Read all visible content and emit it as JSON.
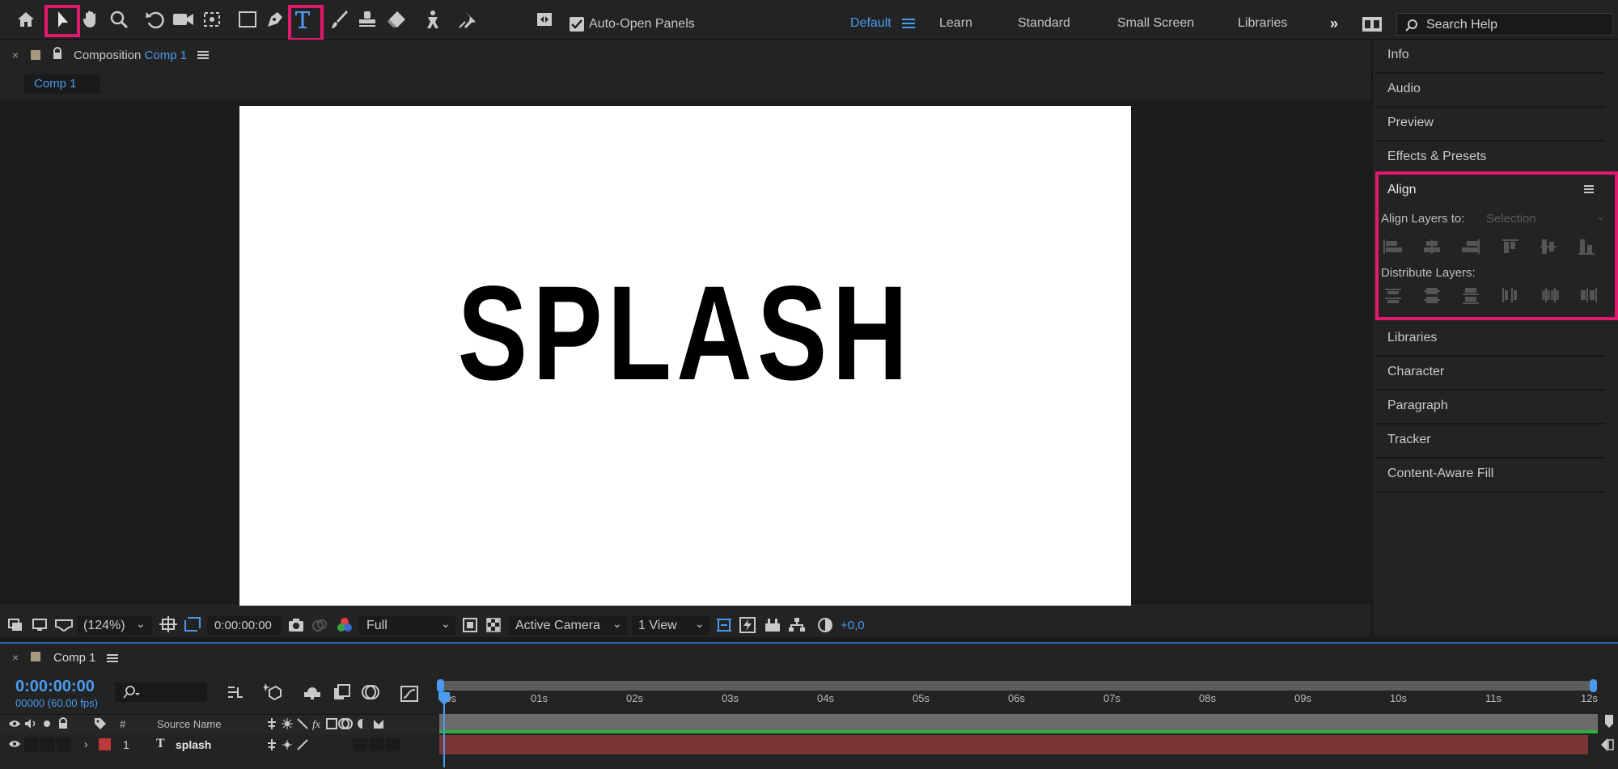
{
  "toolbar": {
    "auto_open_panels": "Auto-Open Panels",
    "workspaces": [
      "Default",
      "Learn",
      "Standard",
      "Small Screen",
      "Libraries"
    ],
    "search_placeholder": "Search Help"
  },
  "composition": {
    "tab_prefix": "Composition",
    "tab_name": "Comp 1",
    "breadcrumb": "Comp 1",
    "canvas_text": "SPLASH"
  },
  "viewer_bar": {
    "zoom": "(124%)",
    "timecode": "0:00:00:00",
    "resolution": "Full",
    "camera": "Active Camera",
    "views": "1 View",
    "exposure": "+0,0"
  },
  "right_panel": {
    "items_top": [
      "Info",
      "Audio",
      "Preview",
      "Effects & Presets"
    ],
    "align": {
      "title": "Align",
      "align_layers_to_label": "Align Layers to:",
      "align_layers_to_value": "Selection",
      "distribute_label": "Distribute Layers:"
    },
    "items_bottom": [
      "Libraries",
      "Character",
      "Paragraph",
      "Tracker",
      "Content-Aware Fill"
    ]
  },
  "timeline": {
    "tab_name": "Comp 1",
    "timecode": "0:00:00:00",
    "frame_info": "00000 (60.00 fps)",
    "column_hash": "#",
    "column_source": "Source Name",
    "ruler": [
      "00s",
      "01s",
      "02s",
      "03s",
      "04s",
      "05s",
      "06s",
      "07s",
      "08s",
      "09s",
      "10s",
      "11s",
      "12s"
    ],
    "layers": [
      {
        "index": "1",
        "type_glyph": "T",
        "name": "splash",
        "label_color": "#c0393a"
      }
    ]
  },
  "colors": {
    "accent": "#4a9bf0",
    "highlight": "#e3196f",
    "layer_bar": "#7a3535"
  }
}
